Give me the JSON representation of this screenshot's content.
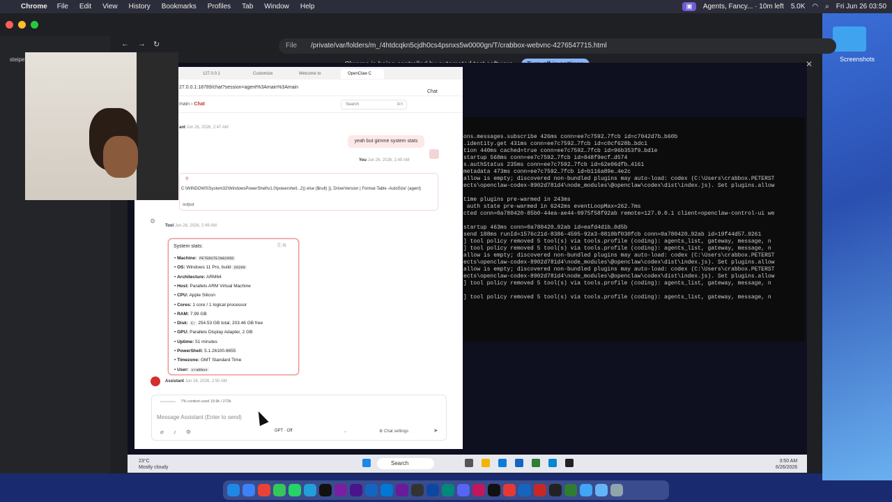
{
  "menubar": {
    "app": "Chrome",
    "items": [
      "File",
      "Edit",
      "View",
      "History",
      "Bookmarks",
      "Profiles",
      "Tab",
      "Window",
      "Help"
    ],
    "status_text": "Agents, Fancy... · 10m left",
    "counter": "5.0K",
    "clock": "Fri Jun 26  03:50",
    "accent": "#6e5bd6"
  },
  "desktop": {
    "screenshots_label": "Screenshots"
  },
  "chrome": {
    "url_scheme": "File",
    "url": "/private/var/folders/m_/4htdcqkn5cjdh0cs4psnxs5w0000gn/T/crabbox-webvnc-4276547715.html",
    "automation_message": "Chrome is being controlled by automated test software",
    "turn_off_label": "Turn off in settings",
    "side_item": "steipete-Parallels-ARM-Virtu..."
  },
  "edge": {
    "tabs": [
      "127.0.0.1",
      "Customize",
      "Welcome to",
      "OpenClaw C"
    ],
    "url": "27.0.0.1:18789/chat?session=agent%3Amain%3Amain",
    "chat_pill": "Chat"
  },
  "app": {
    "crumb_parent": "main",
    "crumb_current": "Chat",
    "search_placeholder": "Search",
    "search_kbd": "⌘K"
  },
  "messages": {
    "first_meta_role": "ant",
    "first_meta_time": "Jun 26, 2026, 2:47 AM",
    "user_text": "yeah but gimme system stats",
    "user_role": "You",
    "user_time": "Jun 26, 2026, 2:49 AM",
    "command": "C:\\WINDOWS\\System32\\WindowsPowerShell\\v1.0\\powershell...2)) else ($null) }}, DriverVersion | Format-Table -AutoSize' (agent)",
    "command_output": "output",
    "tool_role": "Tool",
    "tool_time": "Jun 26, 2026, 2:49 AM",
    "assistant_role": "Assistant",
    "assistant_time": "Jun 26, 2026, 2:50 AM"
  },
  "stats": {
    "title": "System stats:",
    "items": [
      {
        "label": "Machine:",
        "value": "PETERSTEIN8295D",
        "code": true
      },
      {
        "label": "OS:",
        "value": "Windows 11 Pro, build",
        "code_suffix": "26200"
      },
      {
        "label": "Architecture:",
        "value": "ARM64"
      },
      {
        "label": "Host:",
        "value": "Parallels ARM Virtual Machine"
      },
      {
        "label": "CPU:",
        "value": "Apple Silicon"
      },
      {
        "label": "Cores:",
        "value": "1 core / 1 logical processor"
      },
      {
        "label": "RAM:",
        "value": "7.99 GB"
      },
      {
        "label": "Disk:",
        "code_prefix": "C:",
        "value": "254.53 GB total, 203.46 GB free"
      },
      {
        "label": "GPU:",
        "value": "Parallels Display Adapter, 2 GB"
      },
      {
        "label": "Uptime:",
        "value": "51 minutes"
      },
      {
        "label": "PowerShell:",
        "value": "5.1.26100.8655"
      },
      {
        "label": "Timezone:",
        "value": "GMT Standard Time"
      },
      {
        "label": "User:",
        "value": "crabbox",
        "code": true
      }
    ]
  },
  "composer": {
    "context_text": "7% context used  19.9k / 272k",
    "placeholder": "Message Assistant (Enter to send)",
    "model": "GPT · Off",
    "chat_settings_label": "Chat settings"
  },
  "terminal": {
    "lines": [
      "ons.messages.subscribe 426ms conn=ee7c7592…7fcb id=c7042d7b…b60b",
      ".identity.get 431ms conn=ee7c7592…7fcb id=c0cf628b…bdc1",
      "tion 440ms cached=true conn=ee7c7592…7fcb id=96b353f9…bd1e",
      "startup 568ms conn=ee7c7592…7fcb id=848f9ecf…d574",
      "s.authStatus 235ms conn=ee7c7592…7fcb id=62e06dfb…4161",
      "metadata 473ms conn=ee7c7592…7fcb id=b116a89e…4e2c",
      "allow is empty; discovered non-bundled plugins may auto-load: codex (C:\\Users\\crabbox.PETERST",
      "ects\\openclaw-codex-8902d781d4\\node_modules\\@openclaw\\codex\\dist\\index.js). Set plugins.allow",
      "",
      "time plugins pre-warmed in 243ms",
      " auth state pre-warmed in 6242ms eventLoopMax=262.7ms",
      "cted conn=0a780420-85b0-44ea-ae44-0975f58f92ab remote=127.0.0.1 client=openclaw-control-ui we",
      "",
      "startup 463ms conn=0a780420…92ab id=eafd4d1b…0d5b",
      "send 188ms runId=1576c21d-8386-4595-92a3-0810bf030fcb conn=0a780420…92ab id=19f44d57…9261",
      "] tool policy removed 5 tool(s) via tools.profile (coding): agents_list, gateway, message, n",
      "] tool policy removed 5 tool(s) via tools.profile (coding): agents_list, gateway, message, n",
      "allow is empty; discovered non-bundled plugins may auto-load: codex (C:\\Users\\crabbox.PETERST",
      "ects\\openclaw-codex-8902d781d4\\node_modules\\@openclaw\\codex\\dist\\index.js). Set plugins.allow",
      "allow is empty; discovered non-bundled plugins may auto-load: codex (C:\\Users\\crabbox.PETERST",
      "ects\\openclaw-codex-8902d781d4\\node_modules\\@openclaw\\codex\\dist\\index.js). Set plugins.allow",
      "] tool policy removed 5 tool(s) via tools.profile (coding): agents_list, gateway, message, n",
      "",
      "] tool policy removed 5 tool(s) via tools.profile (coding): agents_list, gateway, message, n"
    ]
  },
  "taskbar": {
    "weather_temp": "23°C",
    "weather_desc": "Mostly cloudy",
    "search_label": "Search",
    "time": "3:50 AM",
    "date": "6/26/2026"
  }
}
